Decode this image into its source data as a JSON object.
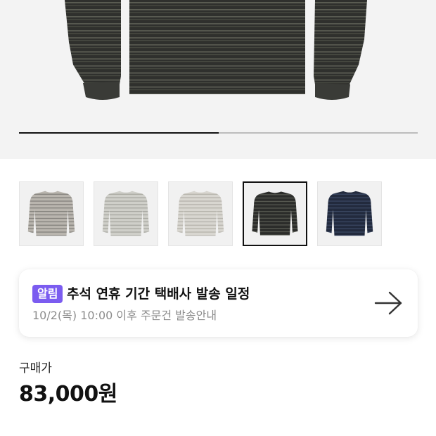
{
  "gallery": {
    "progress": 0.5,
    "thumbnails": [
      {
        "color_name": "gray",
        "body": "#b9b5ae",
        "stripe": "#7d7b76",
        "selected": false
      },
      {
        "color_name": "light-gray",
        "body": "#cfcfc9",
        "stripe": "#a3a39c",
        "selected": false
      },
      {
        "color_name": "ivory",
        "body": "#d8d6d0",
        "stripe": "#b1aea7",
        "selected": false
      },
      {
        "color_name": "black",
        "body": "#2b2c2a",
        "stripe": "#5c5e55",
        "selected": true
      },
      {
        "color_name": "navy",
        "body": "#222a3d",
        "stripe": "#3d4a66",
        "selected": false
      }
    ]
  },
  "notice": {
    "badge": "알림",
    "title": "추석 연휴 기간 택배사 발송 일정",
    "subtitle": "10/2(목) 10:00 이후 주문건 발송안내",
    "arrow_icon": "arrow-right-icon"
  },
  "price": {
    "label": "구매가",
    "value": "83,000원"
  },
  "colors": {
    "accent": "#7b5cf0",
    "product_body": "#2f302d",
    "product_stripe": "#5a5c52"
  }
}
